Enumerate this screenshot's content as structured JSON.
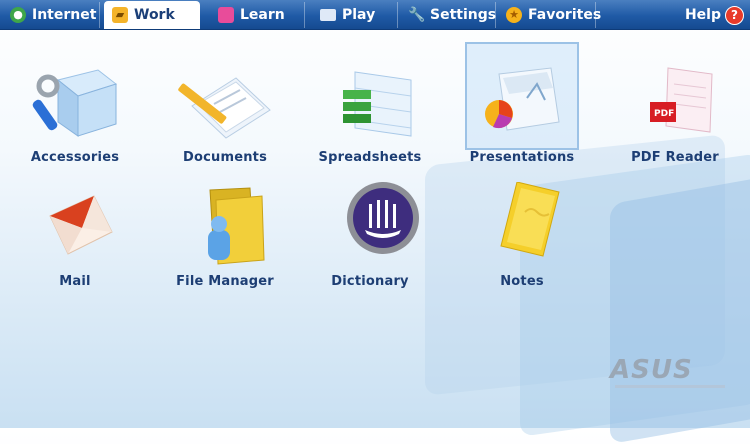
{
  "tabs": [
    {
      "key": "internet",
      "label": "Internet",
      "icon": "globe-icon",
      "color": "#4caf50"
    },
    {
      "key": "work",
      "label": "Work",
      "icon": "briefcase-icon",
      "color": "#f0a020",
      "active": true
    },
    {
      "key": "learn",
      "label": "Learn",
      "icon": "book-icon",
      "color": "#e84c9a"
    },
    {
      "key": "play",
      "label": "Play",
      "icon": "monitor-icon",
      "color": "#dfe9f7"
    },
    {
      "key": "settings",
      "label": "Settings",
      "icon": "wrench-icon",
      "color": "#cfd8e6"
    },
    {
      "key": "favorites",
      "label": "Favorites",
      "icon": "star-icon",
      "color": "#f6b21b"
    }
  ],
  "help": {
    "label": "Help",
    "glyph": "?"
  },
  "apps": [
    {
      "label": "Accessories",
      "icon": "accessories-icon"
    },
    {
      "label": "Documents",
      "icon": "documents-icon"
    },
    {
      "label": "Spreadsheets",
      "icon": "spreadsheets-icon"
    },
    {
      "label": "Presentations",
      "icon": "presentations-icon",
      "selected": true
    },
    {
      "label": "PDF Reader",
      "icon": "pdf-reader-icon"
    },
    {
      "label": "Mail",
      "icon": "mail-icon"
    },
    {
      "label": "File Manager",
      "icon": "file-manager-icon"
    },
    {
      "label": "Dictionary",
      "icon": "dictionary-icon"
    },
    {
      "label": "Notes",
      "icon": "notes-icon"
    }
  ],
  "brand": {
    "logo": "ASUS"
  }
}
